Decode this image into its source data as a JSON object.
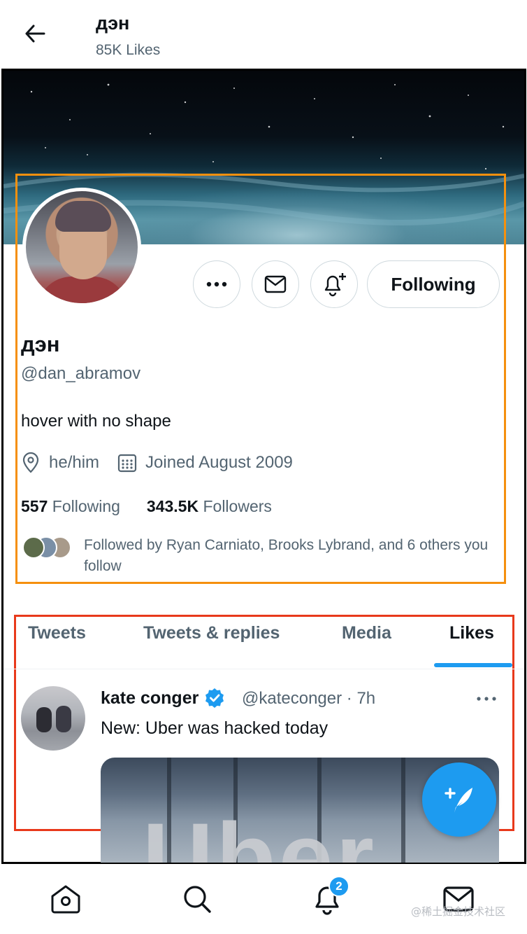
{
  "header": {
    "name": "дэн",
    "likes": "85K Likes"
  },
  "profile": {
    "name": "дэн",
    "handle": "@dan_abramov",
    "bio": "hover with no shape",
    "pronouns": "he/him",
    "joined": "Joined August 2009",
    "following_count": "557",
    "following_label": "Following",
    "followers_count": "343.5K",
    "followers_label": "Followers",
    "followed_by": "Followed by Ryan Carniato, Brooks Lybrand, and 6 others you follow",
    "follow_button": "Following"
  },
  "tabs": [
    {
      "label": "Tweets",
      "active": false
    },
    {
      "label": "Tweets & replies",
      "active": false
    },
    {
      "label": "Media",
      "active": false
    },
    {
      "label": "Likes",
      "active": true
    }
  ],
  "tweet": {
    "author": "kate conger",
    "handle_time": "@kateconger · 7h",
    "text": "New: Uber was hacked today",
    "image_text": "Uber"
  },
  "nav": {
    "notifications_badge": "2",
    "watermark": "@稀土掘金技术社区"
  },
  "colors": {
    "accent": "#1d9bf0",
    "orange_outline": "#f5900e",
    "red_outline": "#e8391b"
  }
}
